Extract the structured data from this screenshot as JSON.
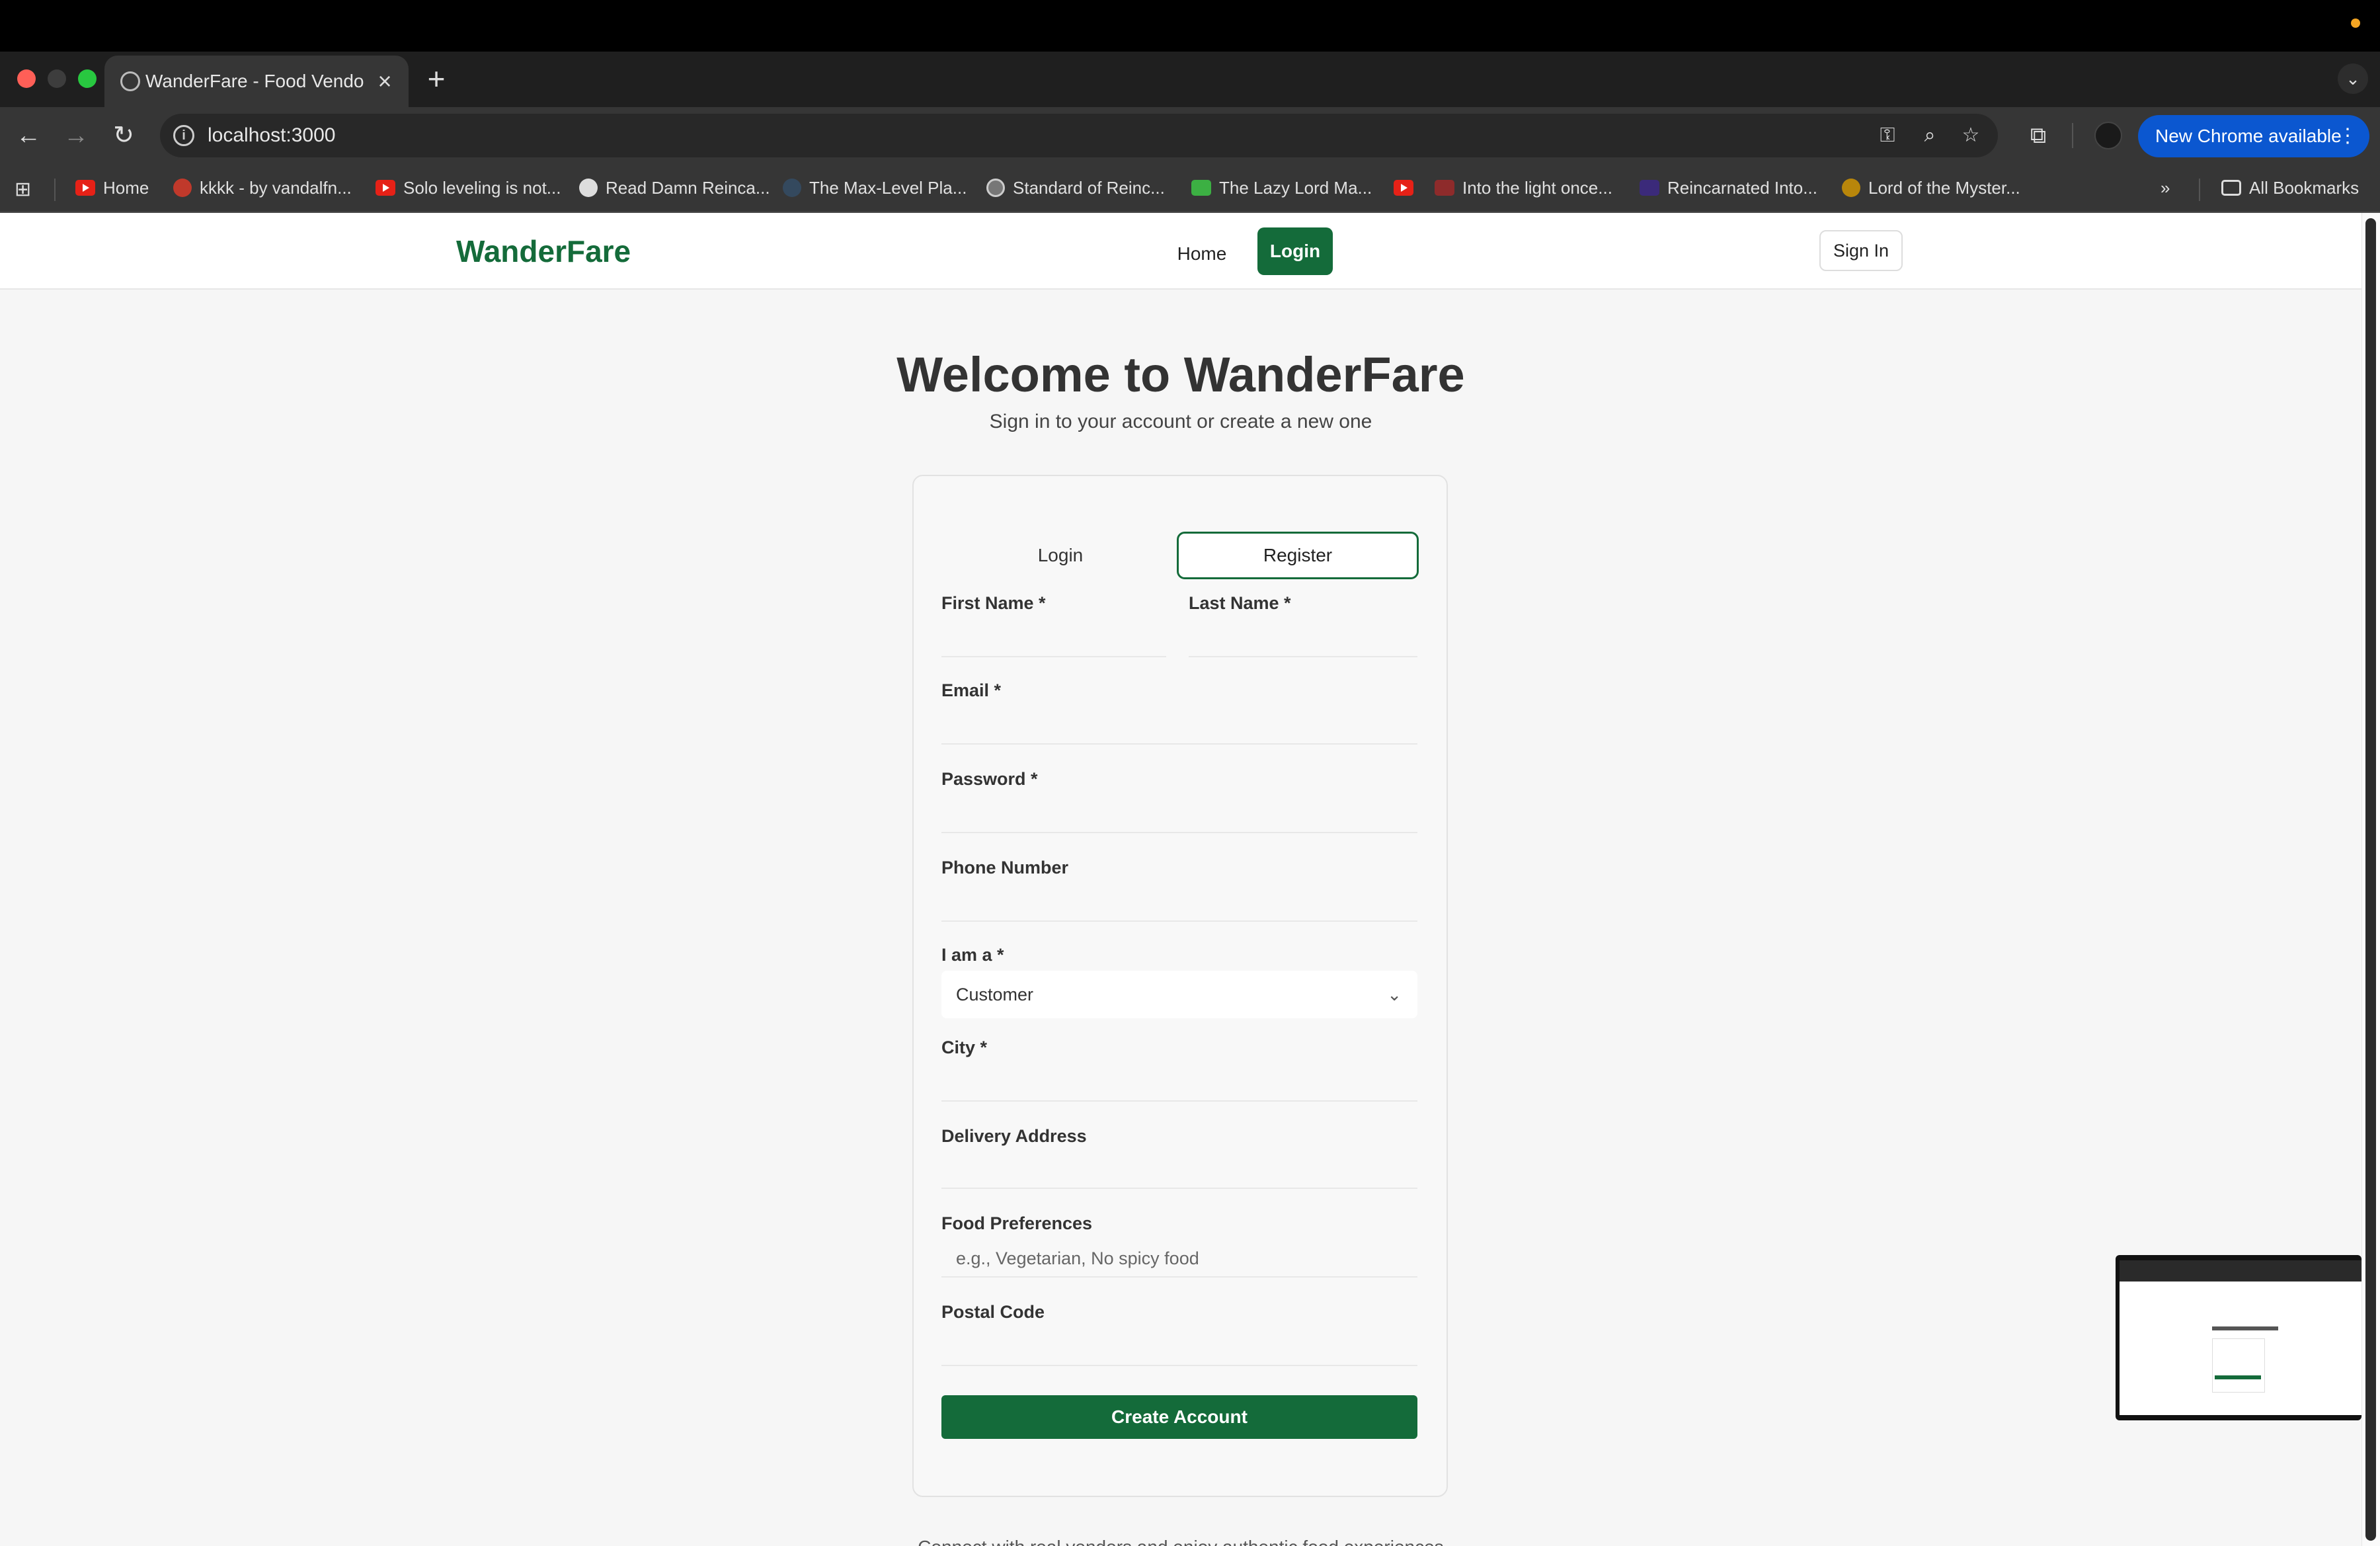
{
  "browser": {
    "tab_title": "WanderFare - Food Vendor Marketplace",
    "url": "localhost:3000",
    "update_label": "New Chrome available",
    "bookmarks": [
      "Home",
      "kkkk - by vandalfn...",
      "Solo leveling is not...",
      "Read Damn Reinca...",
      "The Max-Level Pla...",
      "Standard of Reinc...",
      "The Lazy Lord Ma...",
      "Into the light once...",
      "Reincarnated Into...",
      "Lord of the Myster..."
    ],
    "all_bookmarks": "All Bookmarks"
  },
  "site": {
    "logo": "WanderFare",
    "nav_home": "Home",
    "nav_login": "Login",
    "sign_in": "Sign In"
  },
  "auth": {
    "title": "Welcome to WanderFare",
    "subtitle": "Sign in to your account or create a new one",
    "tab_login": "Login",
    "tab_register": "Register",
    "first_name_label": "First Name *",
    "last_name_label": "Last Name *",
    "email_label": "Email *",
    "password_label": "Password *",
    "phone_label": "Phone Number",
    "role_label": "I am a *",
    "role_value": "Customer",
    "city_label": "City *",
    "address_label": "Delivery Address",
    "food_pref_label": "Food Preferences",
    "food_pref_placeholder": "e.g., Vegetarian, No spicy food",
    "postal_label": "Postal Code",
    "submit_label": "Create Account",
    "footer_text": "Connect with real vendors and enjoy authentic food experiences"
  },
  "colors": {
    "brand_green": "#146b3a",
    "chrome_blue": "#0b57d0"
  }
}
